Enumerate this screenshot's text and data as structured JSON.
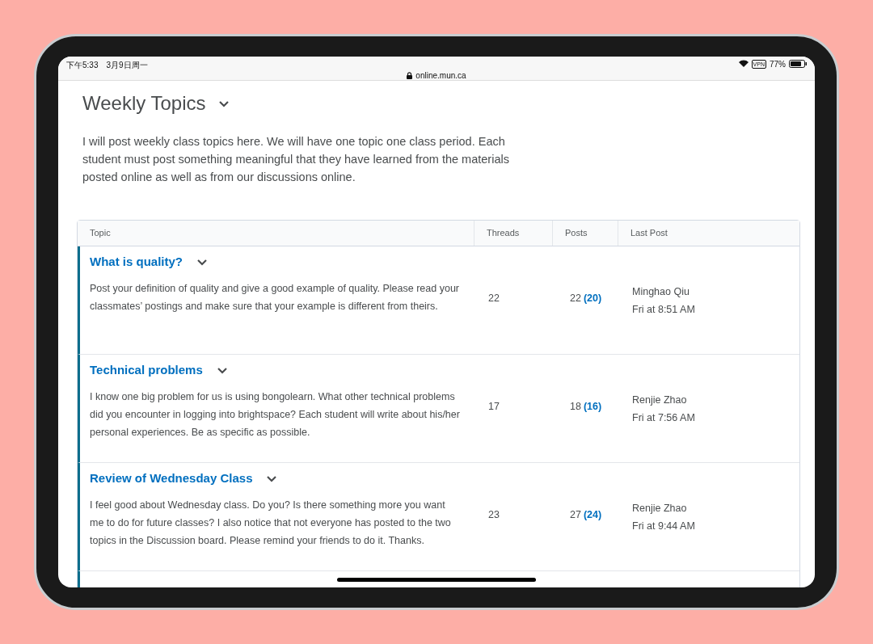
{
  "status_bar": {
    "time": "下午5:33",
    "date": "3月9日周一",
    "url": "online.mun.ca",
    "vpn": "VPN",
    "battery": "77%"
  },
  "page": {
    "title": "Weekly Topics",
    "description": "I will post weekly class topics here.  We will have one topic one class period.  Each student must post something meaningful that they have learned from the materials posted online as well as from our discussions online."
  },
  "table": {
    "columns": [
      "Topic",
      "Threads",
      "Posts",
      "Last Post"
    ],
    "rows": [
      {
        "title": "What is quality?",
        "description": "Post your definition of quality and give a good example of quality.  Please read your classmates’ postings and make sure that your example is different from theirs.",
        "threads": "22",
        "posts": "22",
        "unread": "(20)",
        "author": "Minghao Qiu",
        "time": "Fri at 8:51 AM"
      },
      {
        "title": "Technical problems",
        "description": "I know one big problem for us is using bongolearn.  What other technical problems did you encounter in logging into brightspace?  Each student will write about his/her personal experiences.  Be as specific as possible.",
        "threads": "17",
        "posts": "18",
        "unread": "(16)",
        "author": "Renjie Zhao",
        "time": "Fri at 7:56 AM"
      },
      {
        "title": "Review of Wednesday Class",
        "description": "I feel good about Wednesday class.  Do you?  Is there something more you want me to do for future classes?  I also notice that not everyone has posted to the two topics in the Discussion board.  Please remind your friends to do it.  Thanks.",
        "threads": "23",
        "posts": "27",
        "unread": "(24)",
        "author": "Renjie Zhao",
        "time": "Fri at 9:44 AM"
      }
    ]
  }
}
